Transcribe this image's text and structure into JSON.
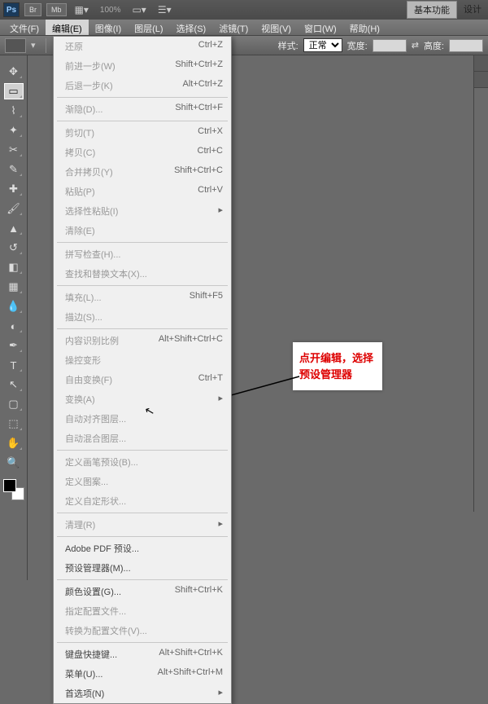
{
  "titlebar": {
    "ps": "Ps",
    "br": "Br",
    "mb": "Mb",
    "zoom": "100%",
    "basic": "基本功能",
    "design": "设计"
  },
  "menubar": {
    "file": "文件(F)",
    "edit": "编辑(E)",
    "image": "图像(I)",
    "layer": "图层(L)",
    "select": "选择(S)",
    "filter": "滤镜(T)",
    "view": "视图(V)",
    "window": "窗口(W)",
    "help": "帮助(H)"
  },
  "optbar": {
    "style_label": "样式:",
    "style_value": "正常",
    "width_label": "宽度:",
    "height_label": "高度:"
  },
  "dropdown": [
    {
      "label": "还原",
      "short": "Ctrl+Z",
      "disabled": true
    },
    {
      "label": "前进一步(W)",
      "short": "Shift+Ctrl+Z",
      "disabled": true
    },
    {
      "label": "后退一步(K)",
      "short": "Alt+Ctrl+Z",
      "disabled": true
    },
    {
      "sep": true
    },
    {
      "label": "渐隐(D)...",
      "short": "Shift+Ctrl+F",
      "disabled": true
    },
    {
      "sep": true
    },
    {
      "label": "剪切(T)",
      "short": "Ctrl+X",
      "disabled": true
    },
    {
      "label": "拷贝(C)",
      "short": "Ctrl+C",
      "disabled": true
    },
    {
      "label": "合并拷贝(Y)",
      "short": "Shift+Ctrl+C",
      "disabled": true
    },
    {
      "label": "粘贴(P)",
      "short": "Ctrl+V",
      "disabled": true
    },
    {
      "label": "选择性粘贴(I)",
      "sub": "▸",
      "disabled": true
    },
    {
      "label": "清除(E)",
      "disabled": true
    },
    {
      "sep": true
    },
    {
      "label": "拼写检查(H)...",
      "disabled": true
    },
    {
      "label": "查找和替换文本(X)...",
      "disabled": true
    },
    {
      "sep": true
    },
    {
      "label": "填充(L)...",
      "short": "Shift+F5",
      "disabled": true
    },
    {
      "label": "描边(S)...",
      "disabled": true
    },
    {
      "sep": true
    },
    {
      "label": "内容识别比例",
      "short": "Alt+Shift+Ctrl+C",
      "disabled": true
    },
    {
      "label": "操控变形",
      "disabled": true
    },
    {
      "label": "自由变换(F)",
      "short": "Ctrl+T",
      "disabled": true
    },
    {
      "label": "变换(A)",
      "sub": "▸",
      "disabled": true
    },
    {
      "label": "自动对齐图层...",
      "disabled": true
    },
    {
      "label": "自动混合图层...",
      "disabled": true
    },
    {
      "sep": true
    },
    {
      "label": "定义画笔预设(B)...",
      "disabled": true
    },
    {
      "label": "定义图案...",
      "disabled": true
    },
    {
      "label": "定义自定形状...",
      "disabled": true
    },
    {
      "sep": true
    },
    {
      "label": "清理(R)",
      "sub": "▸",
      "disabled": true
    },
    {
      "sep": true
    },
    {
      "label": "Adobe PDF 预设...",
      "disabled": false
    },
    {
      "label": "预设管理器(M)...",
      "disabled": false
    },
    {
      "sep": true
    },
    {
      "label": "颜色设置(G)...",
      "short": "Shift+Ctrl+K",
      "disabled": false
    },
    {
      "label": "指定配置文件...",
      "disabled": true
    },
    {
      "label": "转换为配置文件(V)...",
      "disabled": true
    },
    {
      "sep": true
    },
    {
      "label": "键盘快捷键...",
      "short": "Alt+Shift+Ctrl+K",
      "disabled": false
    },
    {
      "label": "菜单(U)...",
      "short": "Alt+Shift+Ctrl+M",
      "disabled": false
    },
    {
      "label": "首选项(N)",
      "sub": "▸",
      "disabled": false
    }
  ],
  "tools": [
    "move",
    "marquee",
    "lasso",
    "wand",
    "crop",
    "eyedrop",
    "heal",
    "brush",
    "stamp",
    "history",
    "eraser",
    "gradient",
    "blur",
    "dodge",
    "pen",
    "type",
    "path",
    "shape",
    "3d",
    "hand",
    "zoom"
  ],
  "callout": "点开编辑，选择预设管理器"
}
